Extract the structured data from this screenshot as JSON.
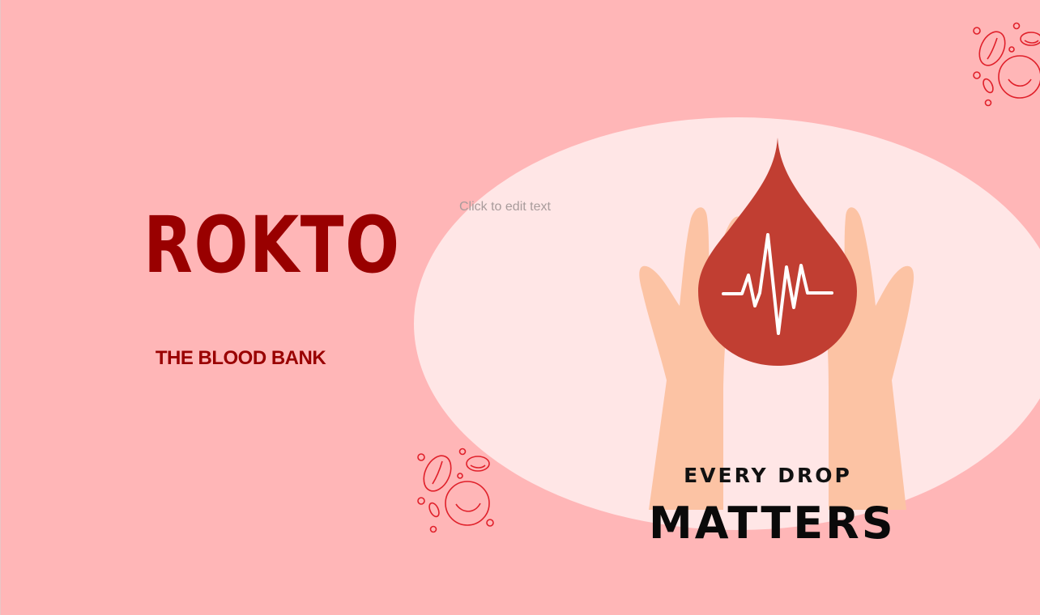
{
  "slide": {
    "title": "ROKTO",
    "subtitle": "THE BLOOD BANK",
    "placeholder": "Click to edit text",
    "tagline_top": "EVERY DROP",
    "tagline_bottom": "MATTERS"
  },
  "colors": {
    "background": "#ffb6b7",
    "oval": "#ffe6e6",
    "title": "#990000",
    "drop": "#c13e32",
    "hand": "#fcc3a4",
    "cell_stroke": "#e0202a"
  },
  "icons": {
    "blood_drop": "blood-drop-icon",
    "heartbeat": "heartbeat-icon",
    "hands": "hands-icon",
    "blood_cells": "blood-cells-icon"
  }
}
